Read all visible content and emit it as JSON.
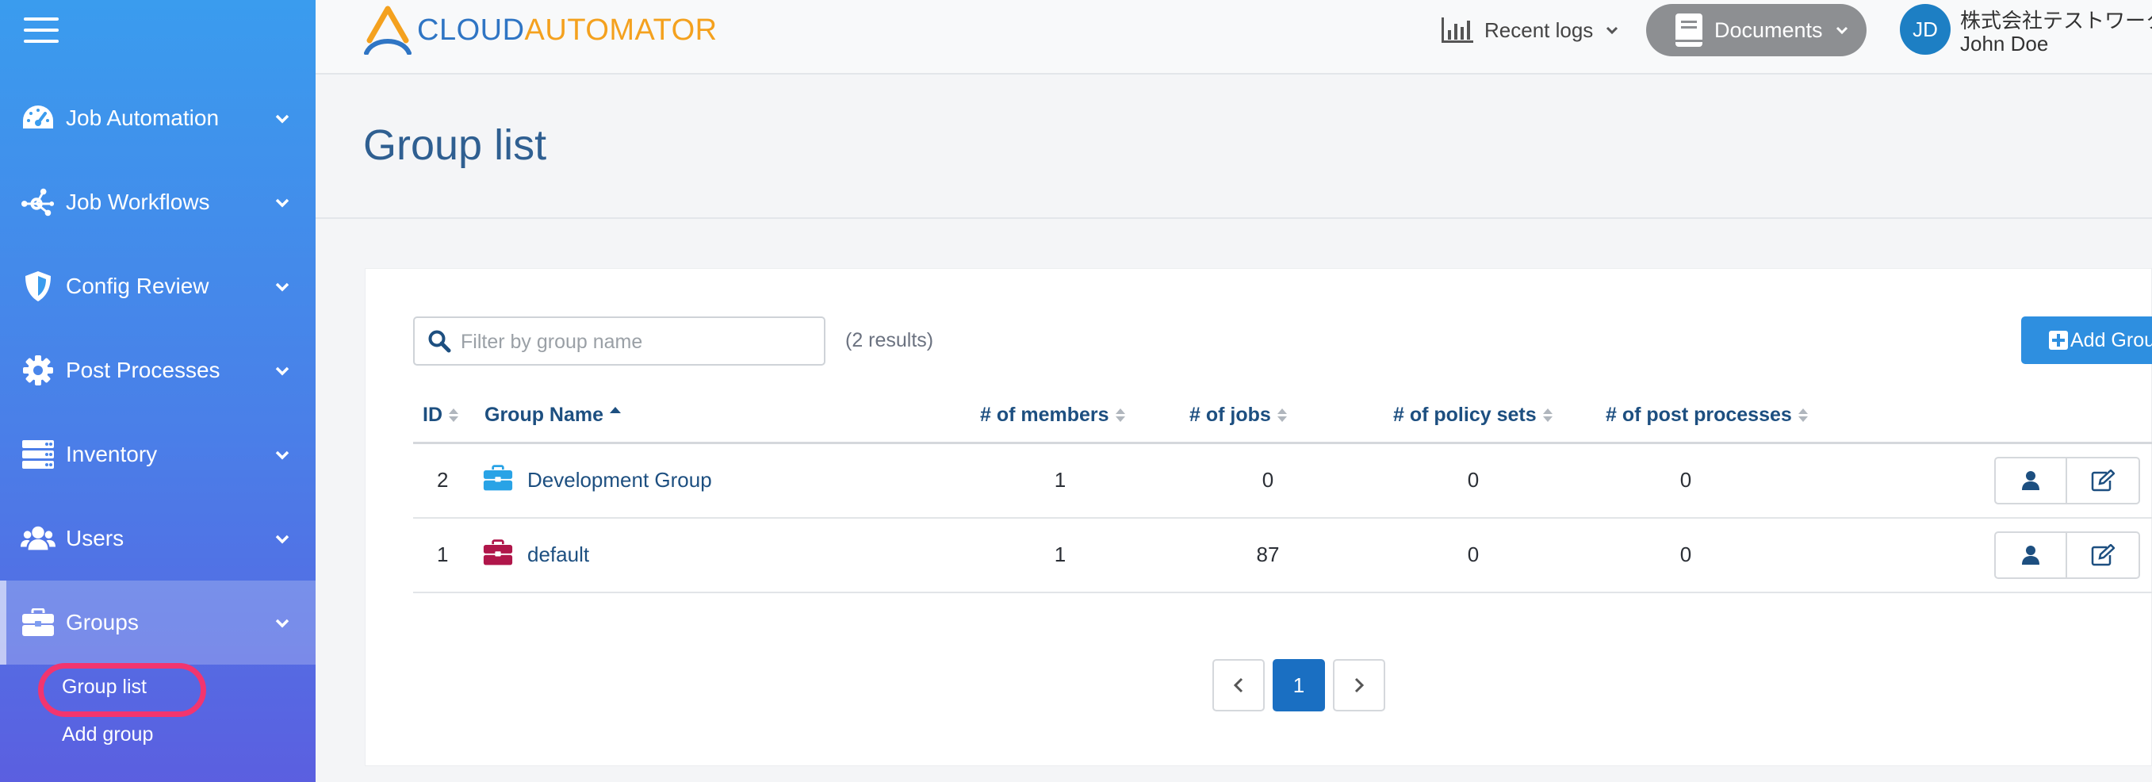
{
  "sidebar": {
    "items": [
      {
        "label": "Job Automation",
        "icon": "dashboard-icon"
      },
      {
        "label": "Job Workflows",
        "icon": "workflow-icon"
      },
      {
        "label": "Config Review",
        "icon": "shield-icon"
      },
      {
        "label": "Post Processes",
        "icon": "gear-icon"
      },
      {
        "label": "Inventory",
        "icon": "server-icon"
      },
      {
        "label": "Users",
        "icon": "users-icon"
      },
      {
        "label": "Groups",
        "icon": "briefcase-icon"
      }
    ],
    "submenu": [
      "Group list",
      "Add group"
    ]
  },
  "header": {
    "logo_part1": "CLOUD",
    "logo_part2": "AUTOMATOR",
    "recent_logs": "Recent logs",
    "documents": "Documents",
    "avatar_initials": "JD",
    "company": "株式会社テストワーク",
    "user_name": "John Doe"
  },
  "page": {
    "title": "Group list",
    "filter_placeholder": "Filter by group name",
    "results": "(2 results)",
    "add_button": "Add Group"
  },
  "table": {
    "columns": [
      "ID",
      "Group Name",
      "# of members",
      "# of jobs",
      "# of policy sets",
      "# of post processes"
    ],
    "rows": [
      {
        "id": "2",
        "name": "Development Group",
        "members": "1",
        "jobs": "0",
        "policy_sets": "0",
        "post_processes": "0",
        "icon_color": "#29a3e6",
        "delete_enabled": true
      },
      {
        "id": "1",
        "name": "default",
        "members": "1",
        "jobs": "87",
        "policy_sets": "0",
        "post_processes": "0",
        "icon_color": "#b0164a",
        "delete_enabled": false
      }
    ]
  },
  "pagination": {
    "current": "1"
  },
  "colors": {
    "accent": "#2e8fe0",
    "highlight": "#f2356f",
    "link": "#1d4f80"
  }
}
